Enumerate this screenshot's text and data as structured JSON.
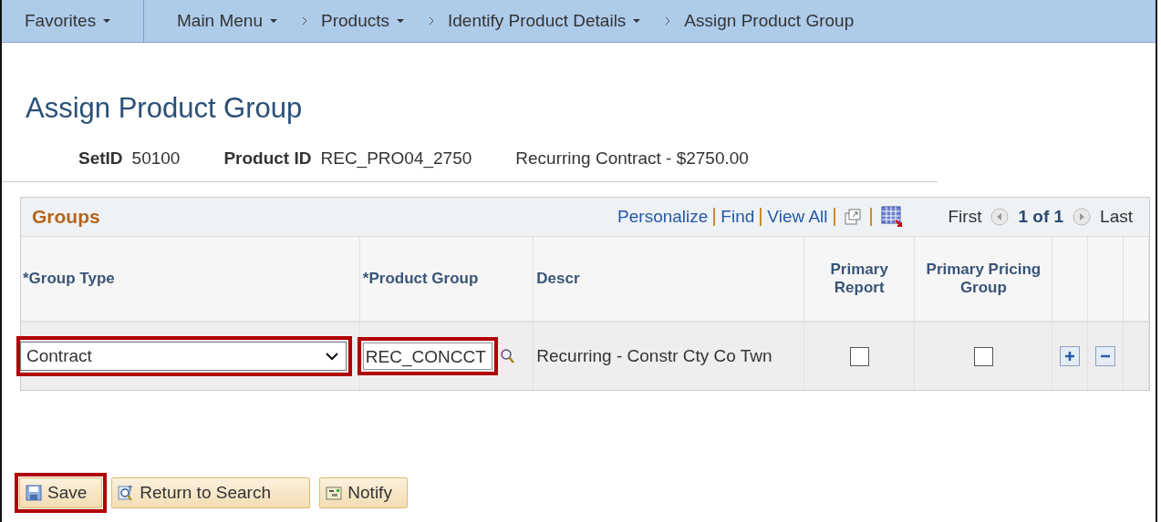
{
  "breadcrumbs": [
    {
      "label": "Favorites",
      "kind": "menu"
    },
    {
      "label": "Main Menu",
      "kind": "menu"
    },
    {
      "label": "Products",
      "kind": "menu"
    },
    {
      "label": "Identify Product Details",
      "kind": "menu"
    },
    {
      "label": "Assign Product Group",
      "kind": "page"
    }
  ],
  "page_title": "Assign Product Group",
  "info": [
    {
      "label": "SetID",
      "value": "50100"
    },
    {
      "label": "Product ID",
      "value": "REC_PRO04_2750"
    },
    {
      "value": "Recurring Contract - $2750.00"
    }
  ],
  "grid": {
    "title": "Groups",
    "links": [
      "Personalize",
      "Find",
      "View All"
    ],
    "nav": {
      "first": "First",
      "count": "1 of 1",
      "last": "Last"
    },
    "columns": [
      "*Group Type",
      "*Product Group",
      "Descr",
      "Primary Report",
      "Primary Pricing Group"
    ],
    "rows": [
      {
        "group_type": "Contract",
        "group_type_highlighted": true,
        "product_group": "REC_CONCCT",
        "product_group_highlighted": true,
        "descr": "Recurring - Constr Cty Co Twn",
        "primary_report": false,
        "primary_pricing_group": false
      }
    ]
  },
  "buttons": [
    {
      "label": "Save",
      "kind": "save",
      "highlighted": true
    },
    {
      "label": "Return to Search",
      "kind": "search",
      "highlighted": false
    },
    {
      "label": "Notify",
      "kind": "notify",
      "highlighted": false
    }
  ]
}
